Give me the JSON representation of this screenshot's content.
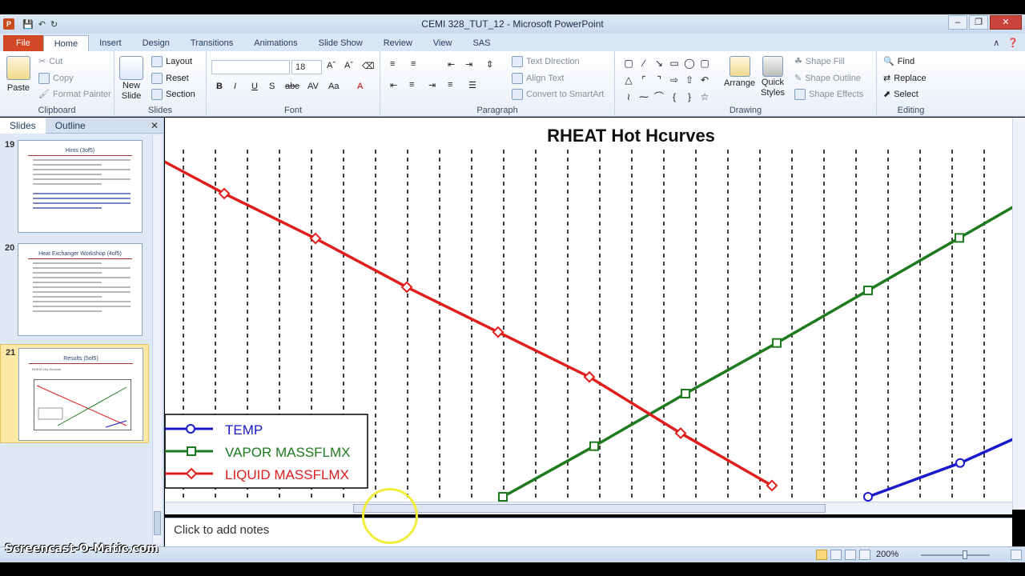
{
  "window": {
    "title": "CEMI 328_TUT_12  -  Microsoft PowerPoint",
    "app_badge": "P"
  },
  "ribbon_tabs": [
    {
      "label": "File"
    },
    {
      "label": "Home"
    },
    {
      "label": "Insert"
    },
    {
      "label": "Design"
    },
    {
      "label": "Transitions"
    },
    {
      "label": "Animations"
    },
    {
      "label": "Slide Show"
    },
    {
      "label": "Review"
    },
    {
      "label": "View"
    },
    {
      "label": "SAS"
    }
  ],
  "clipboard": {
    "paste": "Paste",
    "cut": "Cut",
    "copy": "Copy",
    "format_painter": "Format Painter",
    "label": "Clipboard"
  },
  "slides_group": {
    "new_slide_1": "New",
    "new_slide_2": "Slide",
    "layout": "Layout",
    "reset": "Reset",
    "section": "Section",
    "label": "Slides"
  },
  "font_group": {
    "font_size": "18",
    "label": "Font"
  },
  "paragraph_group": {
    "text_direction": "Text Direction",
    "align_text": "Align Text",
    "convert_smartart": "Convert to SmartArt",
    "label": "Paragraph"
  },
  "drawing_group": {
    "arrange": "Arrange",
    "quick_styles_1": "Quick",
    "quick_styles_2": "Styles",
    "shape_fill": "Shape Fill",
    "shape_outline": "Shape Outline",
    "shape_effects": "Shape Effects",
    "label": "Drawing"
  },
  "editing_group": {
    "find": "Find",
    "replace": "Replace",
    "select": "Select",
    "label": "Editing"
  },
  "slides_pane": {
    "tab_slides": "Slides",
    "tab_outline": "Outline",
    "thumbs": [
      {
        "num": "19",
        "title": "Hints (3of5)"
      },
      {
        "num": "20",
        "title": "Heat Exchanger Workshop (4of5)"
      },
      {
        "num": "21",
        "title": "Results (5of5)",
        "subtitle": "RHEAT Hot Hcurves"
      }
    ]
  },
  "notes": {
    "placeholder": "Click to add notes"
  },
  "status": {
    "zoom": "200%"
  },
  "watermark": "Screencast-O-Matic.com",
  "chart_data": {
    "type": "line",
    "title": "RHEAT Hot Hcurves",
    "xlabel": "",
    "ylabel": "",
    "legend": "bottom-left",
    "grid": "vertical-dashed",
    "series": [
      {
        "name": "TEMP",
        "color": "#1a1acc",
        "marker": "circle",
        "x": [
          0,
          1,
          2
        ],
        "values": [
          0.0,
          0.09,
          0.2
        ]
      },
      {
        "name": "VAPOR MASSFLMX",
        "color": "#1e7a1e",
        "marker": "square",
        "x": [
          0,
          1,
          2,
          3,
          4,
          5,
          6,
          7
        ],
        "values": [
          0.0,
          0.135,
          0.275,
          0.41,
          0.55,
          0.69,
          0.83,
          0.97
        ]
      },
      {
        "name": "LIQUID MASSFLMX",
        "color": "#e01e1e",
        "marker": "diamond",
        "x": [
          0,
          1,
          2,
          3,
          4,
          5,
          6,
          7
        ],
        "values": [
          0.94,
          0.81,
          0.69,
          0.56,
          0.44,
          0.32,
          0.17,
          0.03
        ]
      }
    ]
  }
}
